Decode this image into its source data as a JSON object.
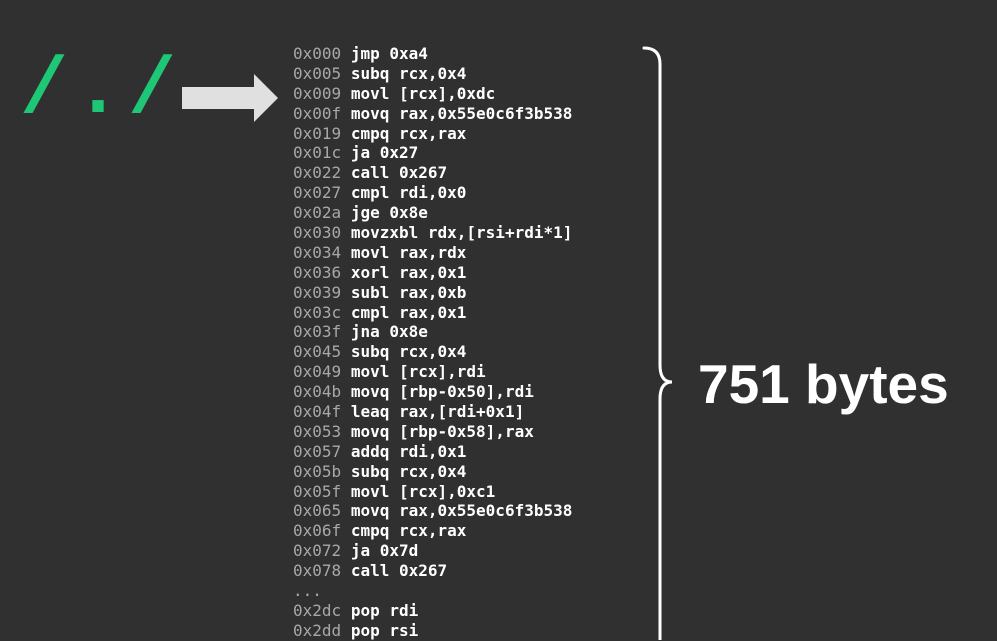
{
  "slide": {
    "regex_text": "/./",
    "regex_color": "#1ec776",
    "background_color": "#303030",
    "arrow_color": "#e0e0e0",
    "size_label": "751 bytes"
  },
  "code": {
    "lines": [
      {
        "addr": "0x000",
        "instr": "jmp 0xa4"
      },
      {
        "addr": "0x005",
        "instr": "subq rcx,0x4"
      },
      {
        "addr": "0x009",
        "instr": "movl [rcx],0xdc"
      },
      {
        "addr": "0x00f",
        "instr": "movq rax,0x55e0c6f3b538"
      },
      {
        "addr": "0x019",
        "instr": "cmpq rcx,rax"
      },
      {
        "addr": "0x01c",
        "instr": "ja 0x27"
      },
      {
        "addr": "0x022",
        "instr": "call 0x267"
      },
      {
        "addr": "0x027",
        "instr": "cmpl rdi,0x0"
      },
      {
        "addr": "0x02a",
        "instr": "jge 0x8e"
      },
      {
        "addr": "0x030",
        "instr": "movzxbl rdx,[rsi+rdi*1]"
      },
      {
        "addr": "0x034",
        "instr": "movl rax,rdx"
      },
      {
        "addr": "0x036",
        "instr": "xorl rax,0x1"
      },
      {
        "addr": "0x039",
        "instr": "subl rax,0xb"
      },
      {
        "addr": "0x03c",
        "instr": "cmpl rax,0x1"
      },
      {
        "addr": "0x03f",
        "instr": "jna 0x8e"
      },
      {
        "addr": "0x045",
        "instr": "subq rcx,0x4"
      },
      {
        "addr": "0x049",
        "instr": "movl [rcx],rdi"
      },
      {
        "addr": "0x04b",
        "instr": "movq [rbp-0x50],rdi"
      },
      {
        "addr": "0x04f",
        "instr": "leaq rax,[rdi+0x1]"
      },
      {
        "addr": "0x053",
        "instr": "movq [rbp-0x58],rax"
      },
      {
        "addr": "0x057",
        "instr": "addq rdi,0x1"
      },
      {
        "addr": "0x05b",
        "instr": "subq rcx,0x4"
      },
      {
        "addr": "0x05f",
        "instr": "movl [rcx],0xc1"
      },
      {
        "addr": "0x065",
        "instr": "movq rax,0x55e0c6f3b538"
      },
      {
        "addr": "0x06f",
        "instr": "cmpq rcx,rax"
      },
      {
        "addr": "0x072",
        "instr": "ja 0x7d"
      },
      {
        "addr": "0x078",
        "instr": "call 0x267"
      }
    ],
    "ellipsis": "...",
    "tail_lines": [
      {
        "addr": "0x2dc",
        "instr": "pop rdi"
      },
      {
        "addr": "0x2dd",
        "instr": "pop rsi"
      }
    ]
  }
}
